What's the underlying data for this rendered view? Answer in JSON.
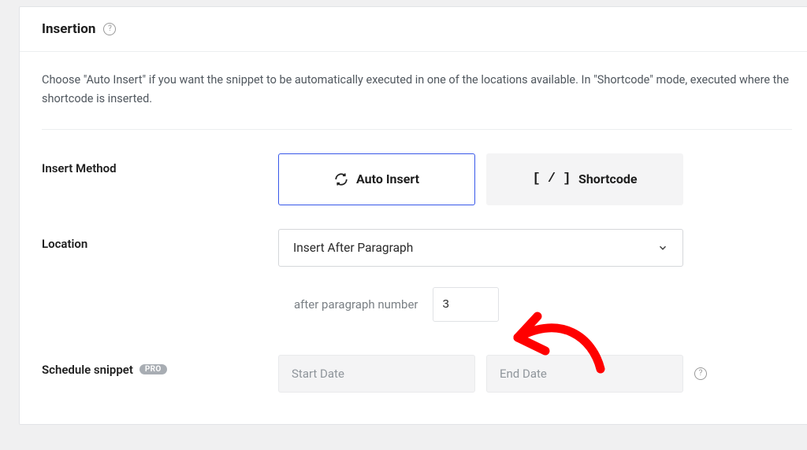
{
  "panel": {
    "title": "Insertion",
    "description": "Choose \"Auto Insert\" if you want the snippet to be automatically executed in one of the locations available. In \"Shortcode\" mode, executed where the shortcode is inserted."
  },
  "insert_method": {
    "label": "Insert Method",
    "auto_insert": "Auto Insert",
    "shortcode": "Shortcode"
  },
  "location": {
    "label": "Location",
    "selected": "Insert After Paragraph",
    "sub_label": "after paragraph number",
    "value": "3"
  },
  "schedule": {
    "label": "Schedule snippet",
    "badge": "PRO",
    "start_placeholder": "Start Date",
    "end_placeholder": "End Date"
  }
}
